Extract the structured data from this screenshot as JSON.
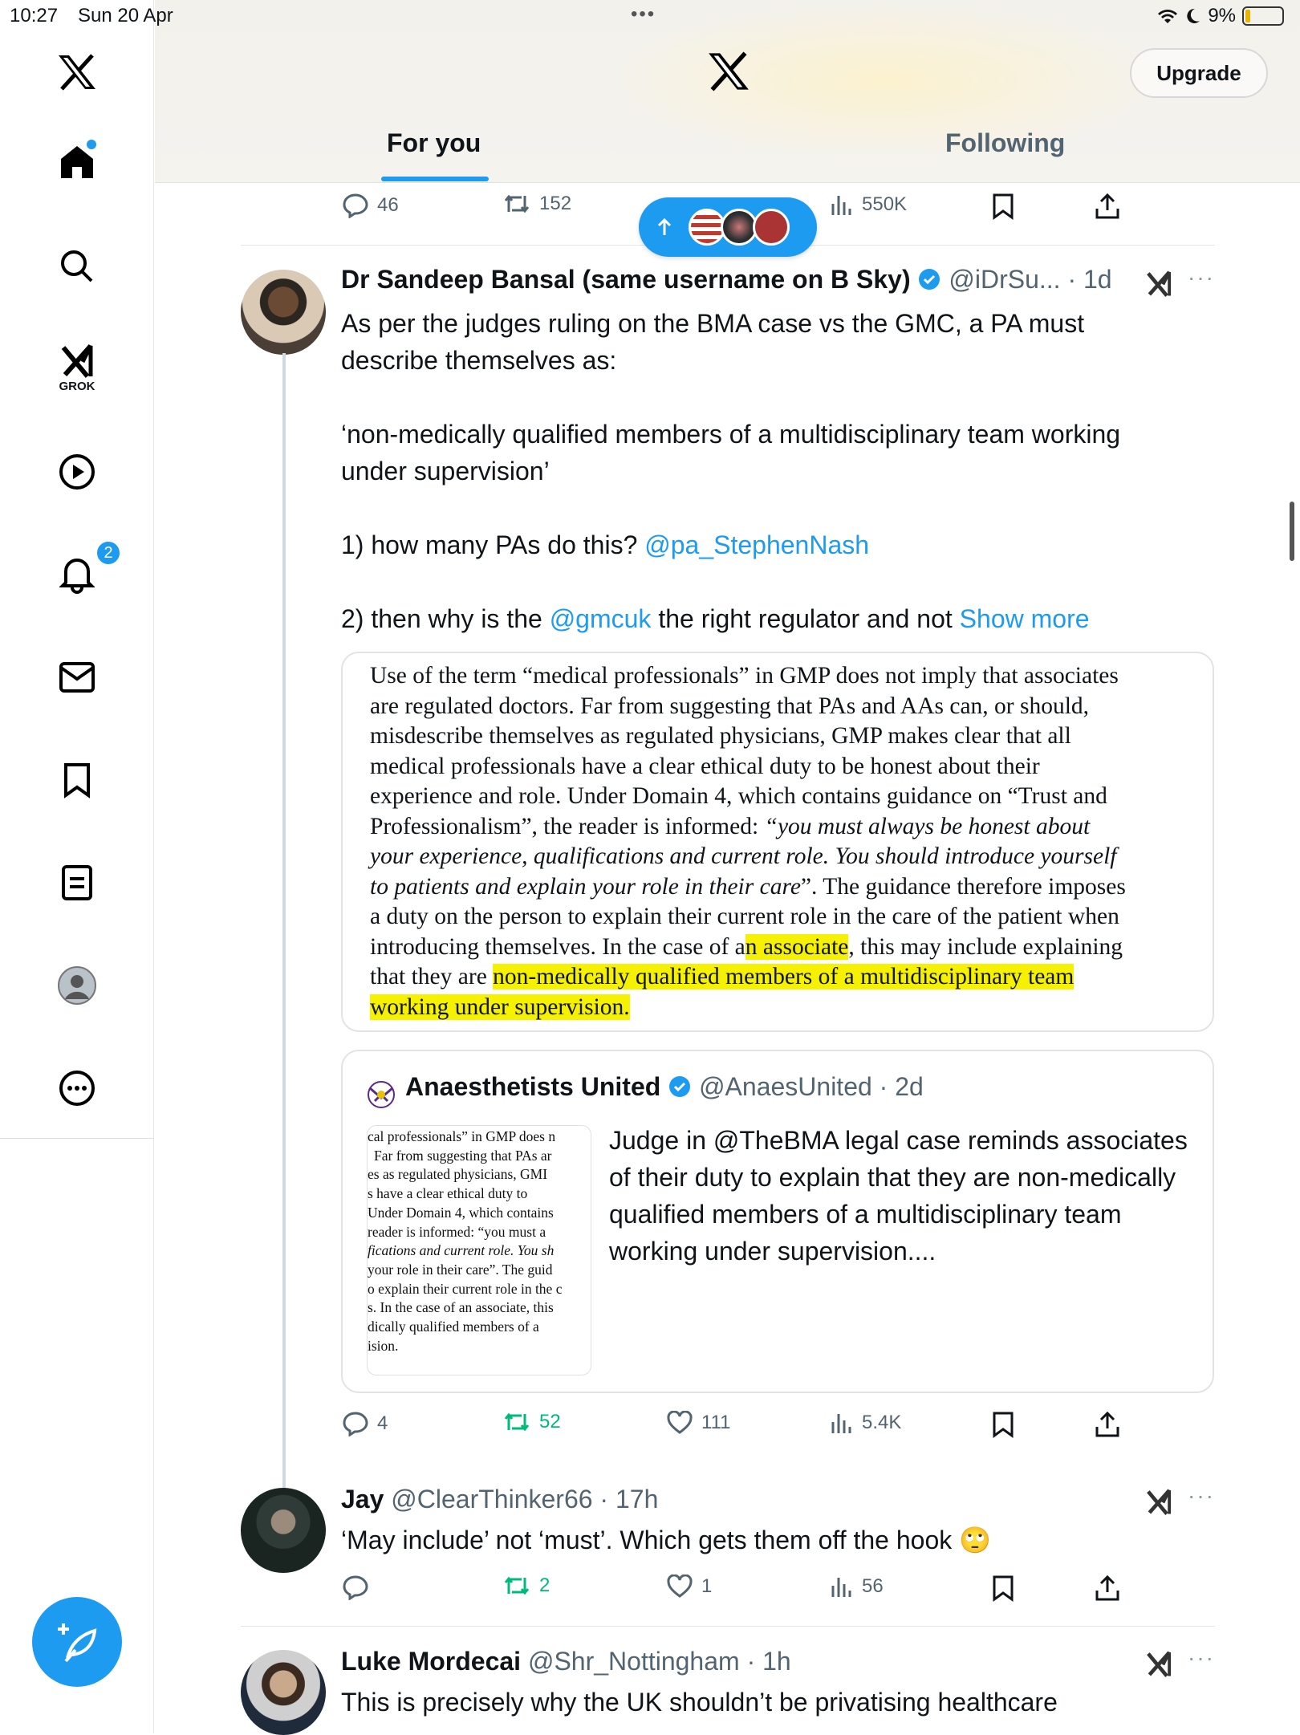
{
  "status_bar": {
    "time": "10:27",
    "date": "Sun 20 Apr",
    "battery": "9%"
  },
  "sidebar": {
    "badge_count": "2",
    "grok_label": "GROK"
  },
  "header": {
    "upgrade_label": "Upgrade",
    "tabs": [
      {
        "label": "For you",
        "active": true
      },
      {
        "label": "Following",
        "active": false
      }
    ]
  },
  "top_actions": {
    "replies": "46",
    "reposts": "152",
    "views": "550K"
  },
  "tweet1": {
    "name": "Dr Sandeep Bansal (same username on B Sky)",
    "handle": "@iDrSu...",
    "time": "· 1d",
    "line1": "As per the judges ruling on the BMA case vs the GMC, a PA must",
    "line2": "describe themselves as:",
    "line3": "‘non-medically qualified members of a multidisciplinary team working",
    "line4": "under supervision’",
    "line5_a": "1) how many PAs do this? ",
    "line5_link": "@pa_StephenNash",
    "line6_a": "2) then why is the ",
    "line6_link": "@gmcuk",
    "line6_b": " the right regulator and not ",
    "show_more": "Show more",
    "image_text": {
      "l1": "Use of the term “medical professionals” in GMP does not imply that associates",
      "l2": "are regulated doctors. Far from suggesting that PAs and AAs can, or should,",
      "l3": "misdescribe themselves as regulated physicians, GMP makes clear that all",
      "l4": "medical professionals have a clear ethical duty to be honest about their",
      "l5": "experience and role. Under Domain 4, which contains guidance on “Trust and",
      "l6a": "Professionalism”, the reader is informed: ",
      "l6b": "“you must always be honest about",
      "l7": "your experience, qualifications and current role. You should introduce yourself",
      "l8a": "to patients and explain your role in their care",
      "l8b": "”. The guidance therefore imposes",
      "l9": "a duty on the person to explain their current role in the care of the patient when",
      "l10a": "introducing themselves. In the case of a",
      "l10b": "n associate",
      "l10c": ", this may include explaining",
      "l11a": "that they are ",
      "l11b": "non-medically qualified members of a multidisciplinary team",
      "l12": "working under supervision."
    },
    "quoted": {
      "name": "Anaesthetists United",
      "handle": "@AnaesUnited",
      "time": "· 2d",
      "text": "Judge in @TheBMA legal case reminds associates of their duty to explain that they are non-medically qualified members of a multidisciplinary team working under supervision....",
      "thumb_lines": [
        "cal professionals” in GMP does n",
        "Far from suggesting that PAs ar",
        "es as regulated physicians, GMI",
        "s have a clear ethical duty to",
        "Under Domain 4, which contains",
        "reader is informed: “you must a",
        "fications and current role. You sh",
        "your role in their care”. The guid",
        "o explain their current role in the c",
        "s. In the case of an associate, this",
        "dically qualified members of a",
        "ision."
      ]
    },
    "actions": {
      "replies": "4",
      "reposts": "52",
      "likes": "111",
      "views": "5.4K"
    }
  },
  "tweet2": {
    "name": "Jay",
    "handle": "@ClearThinker66",
    "time": "· 17h",
    "text": "‘May include’ not ‘must’. Which gets them off the hook 🙄",
    "actions": {
      "reposts": "2",
      "likes": "1",
      "views": "56"
    }
  },
  "tweet3": {
    "name": "Luke Mordecai",
    "handle": "@Shr_Nottingham",
    "time": "· 1h",
    "text": "This is precisely why the UK shouldn’t be privatising healthcare"
  },
  "colors": {
    "accent": "#1d9bf0",
    "repost_green": "#00ba7c",
    "highlight": "#f6f100"
  }
}
